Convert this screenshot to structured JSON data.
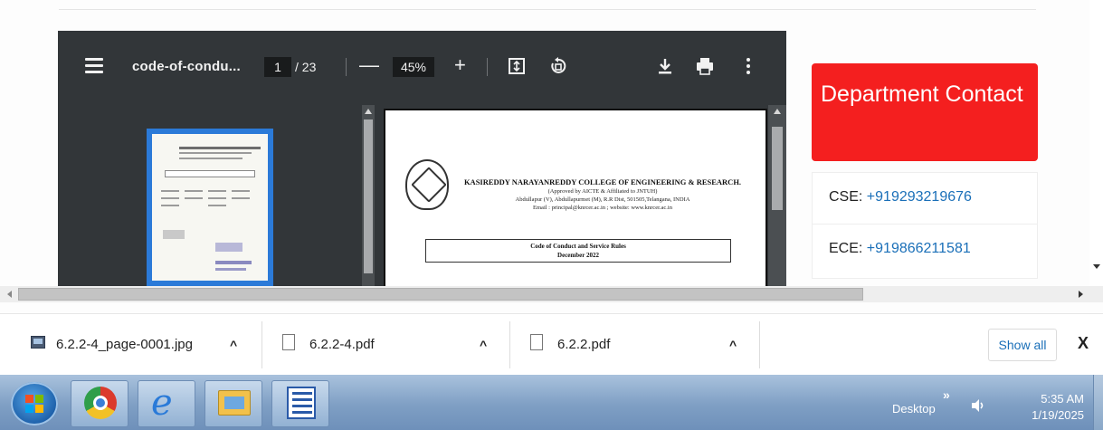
{
  "viewer": {
    "title": "code-of-condu...",
    "page_current": "1",
    "page_total": "/ 23",
    "zoom_minus": "—",
    "zoom": "45%",
    "zoom_plus": "+"
  },
  "document": {
    "college_name": "KASIREDDY NARAYANREDDY COLLEGE OF ENGINEERING & RESEARCH.",
    "approval": "(Approved by AICTE & Affiliated to JNTUH)",
    "address": "Abdullapur (V), Abdullapurmet (M), R.R Dist, 501505,Telangana, INDIA",
    "contact": "Email : principal@knrcer.ac.in ; website: www.knrcer.ac.in",
    "code_title": "Code of Conduct and Service Rules",
    "code_date": "December 2022"
  },
  "sidebar": {
    "header": "Department Contact",
    "contacts": [
      {
        "label": "CSE:",
        "phone": "+919293219676"
      },
      {
        "label": "ECE:",
        "phone": "+919866211581"
      }
    ]
  },
  "downloads": {
    "items": [
      {
        "name": "6.2.2-4_page-0001.jpg",
        "caret": "^"
      },
      {
        "name": "6.2.2-4.pdf",
        "caret": "^"
      },
      {
        "name": "6.2.2.pdf",
        "caret": "^"
      }
    ],
    "show_all": "Show all",
    "close": "X"
  },
  "taskbar": {
    "desktop_label": "Desktop",
    "chevron": "»",
    "time": "5:35 AM",
    "date": "1/19/2025"
  },
  "colors": {
    "accent_red": "#f41f1f",
    "link_blue": "#1a6fb8",
    "viewer_bg": "#323639"
  }
}
